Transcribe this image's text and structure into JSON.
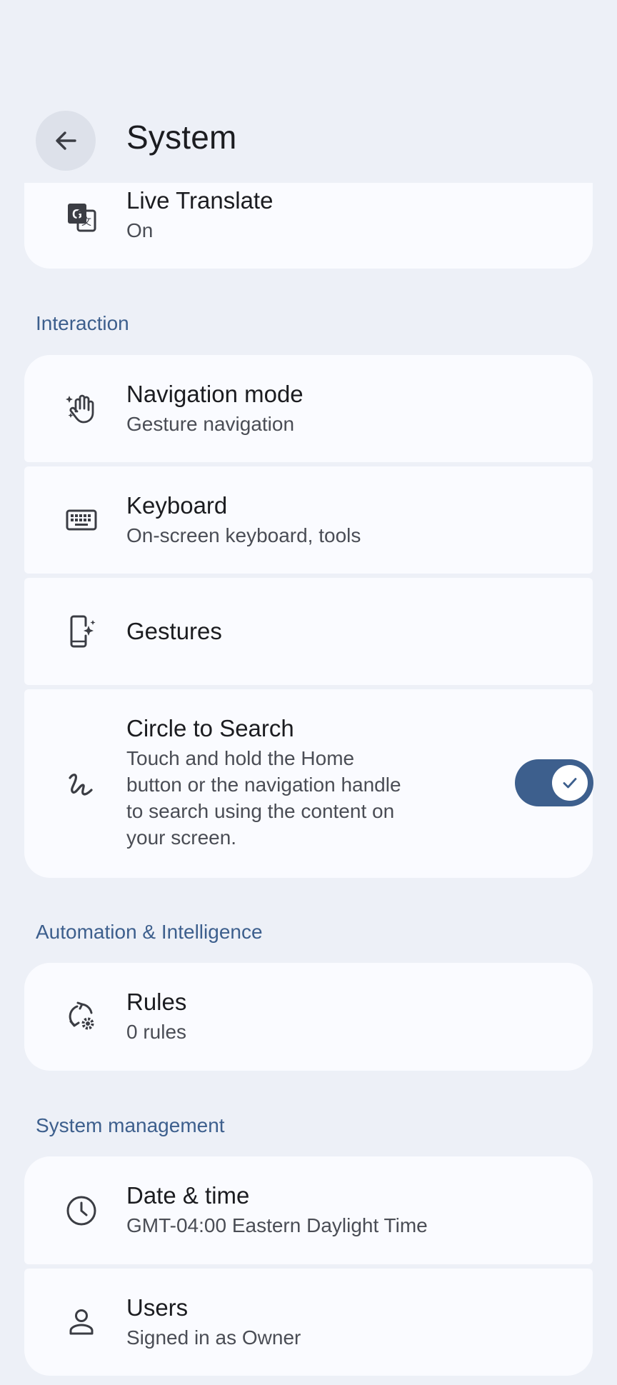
{
  "header": {
    "title": "System",
    "back_icon": "arrow-back-icon"
  },
  "items": {
    "live_translate": {
      "title": "Live Translate",
      "subtitle": "On",
      "icon": "translate-icon"
    },
    "navigation_mode": {
      "title": "Navigation mode",
      "subtitle": "Gesture navigation",
      "icon": "gesture-hand-icon"
    },
    "keyboard": {
      "title": "Keyboard",
      "subtitle": "On-screen keyboard, tools",
      "icon": "keyboard-icon"
    },
    "gestures": {
      "title": "Gestures",
      "icon": "phone-sparkle-icon"
    },
    "circle_to_search": {
      "title": "Circle to Search",
      "subtitle_lines": [
        "Touch and hold the Home",
        "button or the navigation handle",
        "to search using the content on",
        "your screen."
      ],
      "icon": "squiggle-icon",
      "toggle_on": true
    },
    "rules": {
      "title": "Rules",
      "subtitle": "0 rules",
      "icon": "rules-icon"
    },
    "date_time": {
      "title": "Date & time",
      "subtitle": "GMT-04:00 Eastern Daylight Time",
      "icon": "clock-icon"
    },
    "users": {
      "title": "Users",
      "subtitle": "Signed in as Owner",
      "icon": "person-icon"
    }
  },
  "sections": {
    "interaction": "Interaction",
    "automation": "Automation & Intelligence",
    "system_management": "System management"
  },
  "colors": {
    "background": "#edf0f7",
    "card": "#fafbff",
    "accent": "#3d5f8d",
    "text_primary": "#1b1c20",
    "text_secondary": "#4a4d55"
  }
}
